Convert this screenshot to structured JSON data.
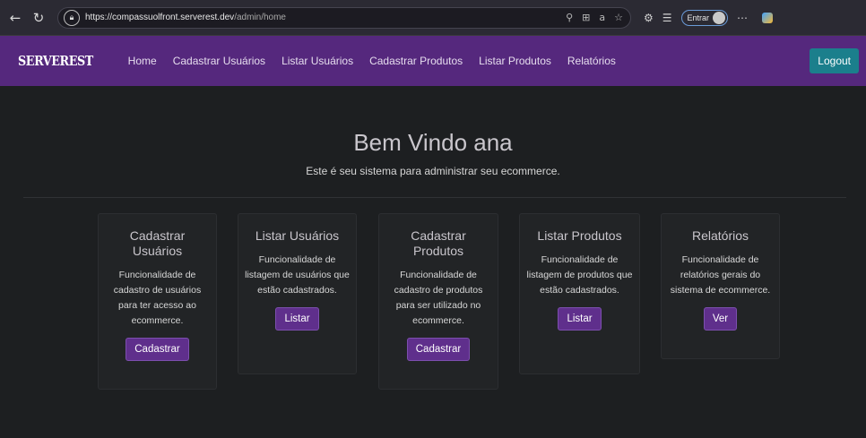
{
  "browser": {
    "url_host": "https://compassuolfront.serverest.dev",
    "url_path": "/admin/home",
    "signin_label": "Entrar"
  },
  "app": {
    "brand": "SERVEREST",
    "nav": [
      "Home",
      "Cadastrar Usuários",
      "Listar Usuários",
      "Cadastrar Produtos",
      "Listar Produtos",
      "Relatórios"
    ],
    "logout_label": "Logout"
  },
  "hero": {
    "title": "Bem Vindo ana",
    "subtitle": "Este é seu sistema para administrar seu ecommerce."
  },
  "cards": [
    {
      "title": "Cadastrar Usuários",
      "text": "Funcionalidade de cadastro de usuários para ter acesso ao ecommerce.",
      "button": "Cadastrar"
    },
    {
      "title": "Listar Usuários",
      "text": "Funcionalidade de listagem de usuários que estão cadastrados.",
      "button": "Listar"
    },
    {
      "title": "Cadastrar Produtos",
      "text": "Funcionalidade de cadastro de produtos para ser utilizado no ecommerce.",
      "button": "Cadastrar"
    },
    {
      "title": "Listar Produtos",
      "text": "Funcionalidade de listagem de produtos que estão cadastrados.",
      "button": "Listar"
    },
    {
      "title": "Relatórios",
      "text": "Funcionalidade de relatórios gerais do sistema de ecommerce.",
      "button": "Ver"
    }
  ],
  "colors": {
    "navbar": "#55287d",
    "logout": "#1b7f8c",
    "card_button": "#5f2f8c",
    "background": "#1d1f21"
  }
}
